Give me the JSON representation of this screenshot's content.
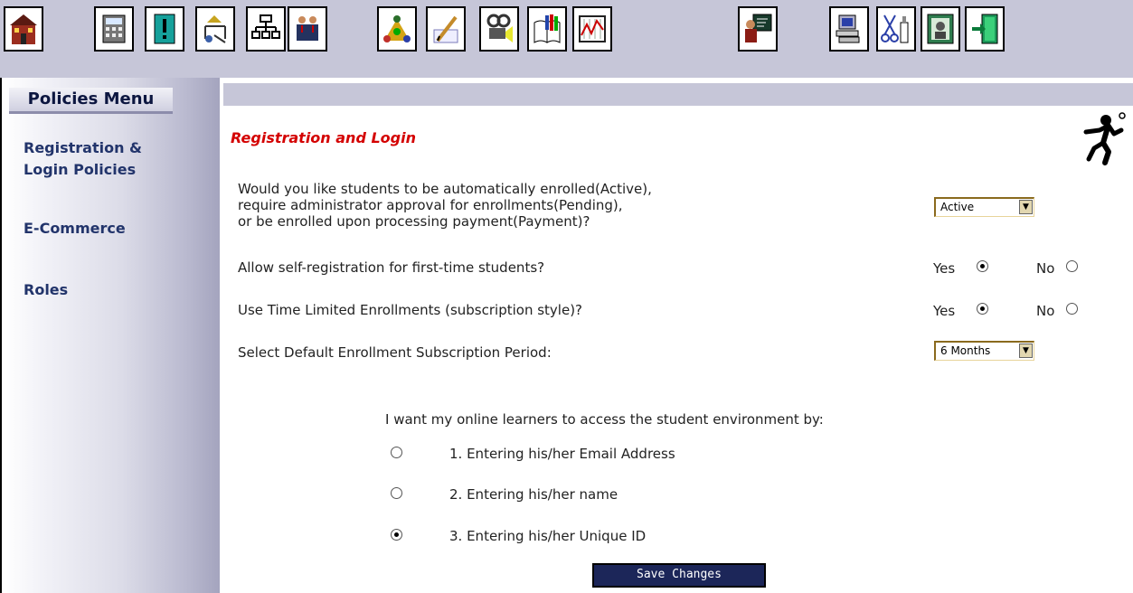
{
  "toolbar": {
    "icons": [
      "home-icon",
      "calculator-icon",
      "alert-icon",
      "move-icon",
      "org-chart-icon",
      "users-icon",
      "group-icon",
      "writing-icon",
      "projector-icon",
      "books-icon",
      "chart-icon",
      "teacher-icon",
      "computer-icon",
      "scissors-tools-icon",
      "portrait-icon",
      "exit-door-icon"
    ]
  },
  "sidebar": {
    "menu_title": "Policies Menu",
    "items": [
      {
        "label_line1": "Registration &",
        "label_line2": "Login Policies"
      },
      {
        "label": "E-Commerce"
      },
      {
        "label": "Roles"
      }
    ]
  },
  "content": {
    "section_title": "Registration and Login",
    "q1_lines": [
      "Would you like students to be automatically enrolled(Active),",
      "require administrator approval for enrollments(Pending),",
      "or be enrolled upon processing payment(Payment)?"
    ],
    "q1_value": "Active",
    "q2": "Allow self-registration for first-time students?",
    "q2_yes": "Yes",
    "q2_no": "No",
    "q2_selected": "Yes",
    "q3": "Use Time Limited Enrollments (subscription style)?",
    "q3_yes": "Yes",
    "q3_no": "No",
    "q3_selected": "Yes",
    "q4": "Select Default Enrollment Subscription Period:",
    "q4_value": "6 Months",
    "access_prompt": "I want my online learners to access the student environment by:",
    "access_options": [
      "1. Entering his/her Email Address",
      "2. Entering his/her name",
      "3. Entering his/her Unique ID"
    ],
    "access_selected_index": 2,
    "save_label": "Save Changes"
  },
  "colors": {
    "toolbar_bg": "#c6c6d8",
    "section_title": "#d40000",
    "sidebar_text": "#22346b",
    "save_button_bg": "#1c2659"
  }
}
